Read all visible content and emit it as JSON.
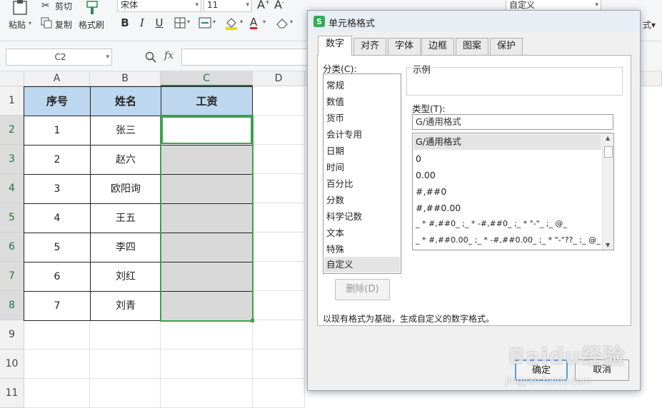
{
  "ribbon": {
    "paste_label": "粘贴",
    "cut_label": "剪切",
    "copy_label": "复制",
    "format_painter_label": "格式刷",
    "font_name": "宋体",
    "font_size": "11",
    "bold": "B",
    "italic": "I",
    "underline": "U",
    "number_format": "自定义"
  },
  "formula_bar": {
    "name_box": "C2",
    "fx": "fx",
    "value": ""
  },
  "grid": {
    "columns": [
      "A",
      "B",
      "C",
      "D"
    ],
    "rows": [
      "1",
      "2",
      "3",
      "4",
      "5",
      "6",
      "7",
      "8",
      "9",
      "10",
      "11"
    ],
    "headers": [
      "序号",
      "姓名",
      "工资"
    ],
    "data": [
      {
        "no": "1",
        "name": "张三"
      },
      {
        "no": "2",
        "name": "赵六"
      },
      {
        "no": "3",
        "name": "欧阳询"
      },
      {
        "no": "4",
        "name": "王五"
      },
      {
        "no": "5",
        "name": "李四"
      },
      {
        "no": "6",
        "name": "刘红"
      },
      {
        "no": "7",
        "name": "刘青"
      }
    ]
  },
  "dialog": {
    "title": "单元格格式",
    "tabs": [
      "数字",
      "对齐",
      "字体",
      "边框",
      "图案",
      "保护"
    ],
    "category_label": "分类(C):",
    "categories": [
      "常规",
      "数值",
      "货币",
      "会计专用",
      "日期",
      "时间",
      "百分比",
      "分数",
      "科学记数",
      "文本",
      "特殊",
      "自定义"
    ],
    "sample_label": "示例",
    "type_label": "类型(T):",
    "type_value": "G/通用格式",
    "type_options": [
      "G/通用格式",
      "0",
      "0.00",
      "#,##0",
      "#,##0.00",
      "_ * #,##0_ ;_ * -#,##0_ ;_ * \"-\"_ ;_ @_",
      "_ * #,##0.00_ ;_ * -#,##0.00_ ;_ * \"-\"??_ ;_ @_"
    ],
    "delete_label": "删除(D)",
    "description": "以现有格式为基础，生成自定义的数字格式。",
    "ok_label": "确定",
    "cancel_label": "取消"
  },
  "watermark": {
    "text": "Baidu经验",
    "url": "jingyan.baidu.com"
  }
}
